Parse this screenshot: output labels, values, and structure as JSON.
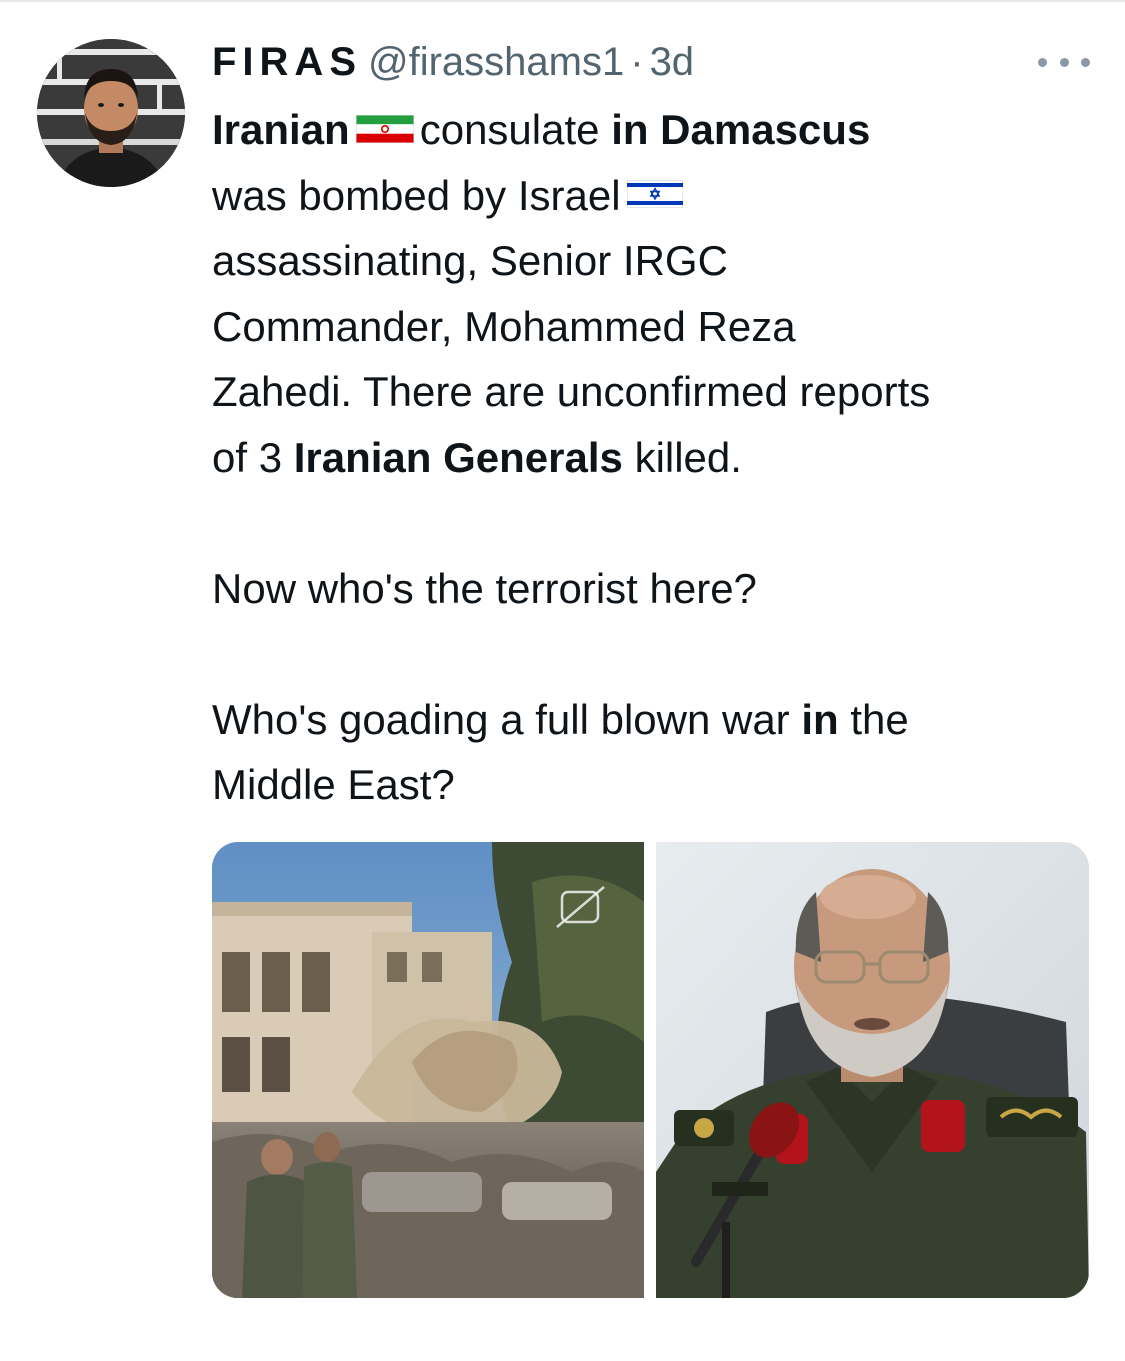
{
  "tweet": {
    "display_name": "FIRAS",
    "handle": "@firasshams1",
    "separator": "·",
    "time": "3d",
    "avatar_icon": "profile-avatar",
    "more_icon": "more-options-icon",
    "text": {
      "l1_a": "Iranian",
      "l1_b": "consulate",
      "l1_c": "in Damascus",
      "l2_a": "was bombed by Israel",
      "l3": "assassinating, Senior IRGC",
      "l4": "Commander, Mohammed Reza",
      "l5": "Zahedi. There are unconfirmed reports",
      "l6_a": "of 3",
      "l6_b": "Iranian Generals",
      "l6_c": "killed.",
      "p2": "Now who's the terrorist here?",
      "p3_a": "Who's goading a full blown war",
      "p3_b": "in",
      "p3_c": "the",
      "p3_d": "Middle East?"
    },
    "flags": {
      "iran": "iran-flag-icon",
      "israel": "israel-flag-icon"
    },
    "media": {
      "left": "bombed-building-photo",
      "right": "commander-portrait-photo"
    }
  }
}
